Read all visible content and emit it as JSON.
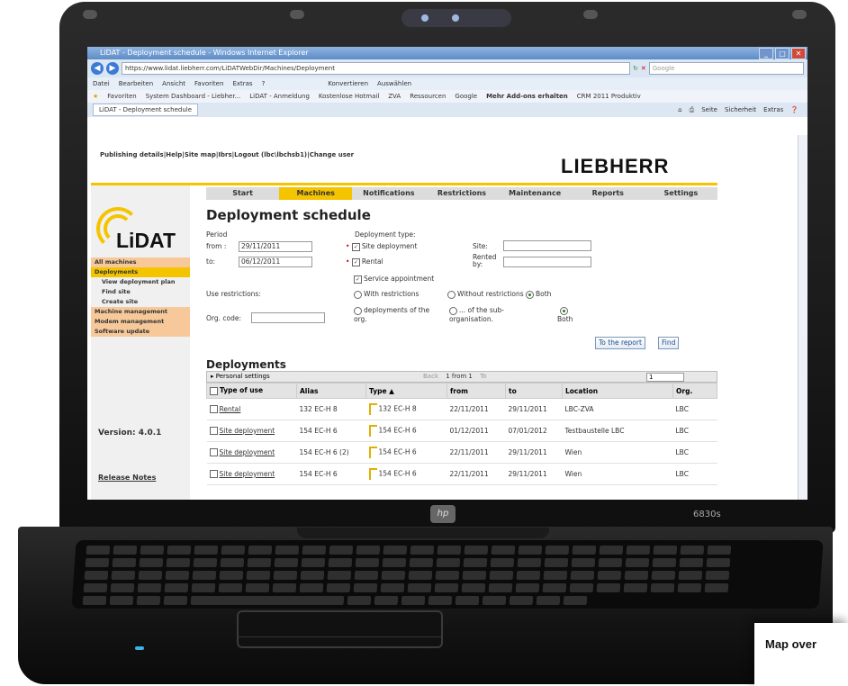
{
  "caption": "Map over",
  "laptop": {
    "model": "6830s",
    "bezel_logo": "hp"
  },
  "browser": {
    "title": "LiDAT - Deployment schedule - Windows Internet Explorer",
    "url": "https://www.lidat.liebherr.com/LiDATWebDir/Machines/Deployment",
    "search_placeholder": "Google",
    "menu_items": [
      "Datei",
      "Bearbeiten",
      "Ansicht",
      "Favoriten",
      "Extras",
      "?"
    ],
    "menu_extra": [
      "Konvertieren",
      "Auswählen"
    ],
    "favorites_label": "Favoriten",
    "favorites": [
      "System Dashboard - Liebher...",
      "LiDAT - Anmeldung",
      "Kostenlose Hotmail",
      "ZVA",
      "Ressourcen",
      "Google",
      "Mehr Add-ons erhalten",
      "CRM 2011 Produktiv"
    ],
    "tab_label": "LiDAT - Deployment schedule",
    "tab_tools": [
      "Seite",
      "Sicherheit",
      "Extras"
    ]
  },
  "header": {
    "top_links": "Publishing details|Help|Site map|Ibrs|Logout (lbc\\lbchsb1)|Change user",
    "brand": "LIEBHERR"
  },
  "nav": {
    "tabs": [
      "Start",
      "Machines",
      "Notifications",
      "Restrictions",
      "Maintenance",
      "Reports",
      "Settings"
    ],
    "active": "Machines"
  },
  "sidebar": {
    "logo_text": "LiDAT",
    "items": [
      {
        "label": "All machines",
        "style": "orange"
      },
      {
        "label": "Deployments",
        "style": "active"
      },
      {
        "label": "View deployment plan",
        "style": "sub"
      },
      {
        "label": "Find site",
        "style": "sub"
      },
      {
        "label": "Create site",
        "style": "sub"
      },
      {
        "label": "Machine management",
        "style": "orange"
      },
      {
        "label": "Modem management",
        "style": "orange"
      },
      {
        "label": "Software update",
        "style": "orange"
      }
    ],
    "version": "Version: 4.0.1",
    "release_notes": "Release Notes"
  },
  "form": {
    "heading": "Deployment schedule",
    "period_label": "Period",
    "from_label": "from :",
    "from_value": "29/11/2011",
    "to_label": "to:",
    "to_value": "06/12/2011",
    "use_restrictions_label": "Use restrictions:",
    "org_code_label": "Org. code:",
    "deployment_type_label": "Deployment type:",
    "site_deployment": "Site deployment",
    "rental": "Rental",
    "service_appointment": "Service appointment",
    "with_restrictions": "With restrictions",
    "without_restrictions": "Without restrictions",
    "both": "Both",
    "deployments_of_org": "deployments of the org.",
    "sub_org": "... of the sub-organisation.",
    "site_label": "Site:",
    "rented_by_label": "Rented by:",
    "to_report_button": "To the report",
    "find_button": "Find"
  },
  "deployments": {
    "heading": "Deployments",
    "personal_settings": "Personal settings",
    "pager_back": "Back",
    "pager_text": "1 from 1",
    "pager_to": "To",
    "page_value": "1",
    "columns": [
      "Type of use",
      "Alias",
      "Type ▲",
      "from",
      "to",
      "Location",
      "Org."
    ],
    "rows": [
      {
        "type_of_use": "Rental",
        "alias": "132 EC-H 8",
        "type": "132 EC-H 8",
        "from": "22/11/2011",
        "to": "29/11/2011",
        "location": "LBC-ZVA",
        "org": "LBC"
      },
      {
        "type_of_use": "Site deployment",
        "alias": "154 EC-H 6",
        "type": "154 EC-H 6",
        "from": "01/12/2011",
        "to": "07/01/2012",
        "location": "Testbaustelle LBC",
        "org": "LBC"
      },
      {
        "type_of_use": "Site deployment",
        "alias": "154 EC-H 6 (2)",
        "type": "154 EC-H 6",
        "from": "22/11/2011",
        "to": "29/11/2011",
        "location": "Wien",
        "org": "LBC"
      },
      {
        "type_of_use": "Site deployment",
        "alias": "154 EC-H 6",
        "type": "154 EC-H 6",
        "from": "22/11/2011",
        "to": "29/11/2011",
        "location": "Wien",
        "org": "LBC"
      }
    ]
  }
}
